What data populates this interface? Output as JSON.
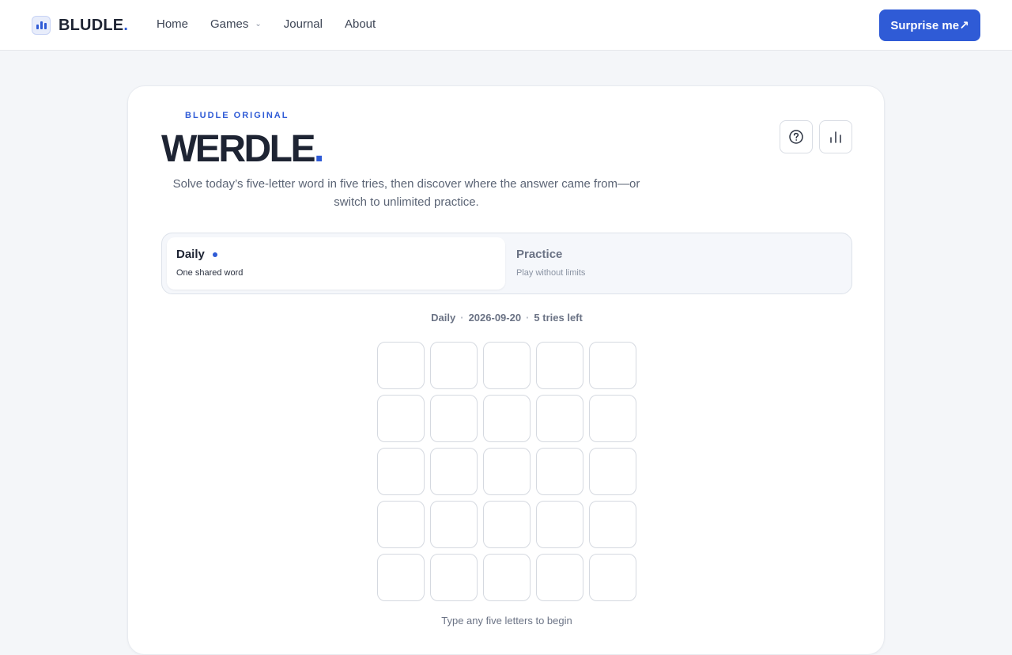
{
  "header": {
    "brand": "BLUDLE",
    "brand_dot": ".",
    "nav": [
      {
        "label": "Home"
      },
      {
        "label": "Games",
        "has_dropdown": true
      },
      {
        "label": "Journal"
      },
      {
        "label": "About"
      }
    ],
    "cta_label": "Surprise me↗"
  },
  "game": {
    "eyebrow": "BLUDLE ORIGINAL",
    "title": "WERDLE",
    "title_dot": ".",
    "subtitle": "Solve today’s five-letter word in five tries, then discover where the answer came from—or switch to unlimited practice.",
    "modes": [
      {
        "title": "Daily",
        "subtitle": "One shared word",
        "active": true
      },
      {
        "title": "Practice",
        "subtitle": "Play without limits",
        "active": false
      }
    ],
    "status": {
      "mode": "Daily",
      "date": "2026-09-20",
      "tries_left": "5 tries left"
    },
    "board": {
      "rows": 5,
      "cols": 5
    },
    "hint": "Type any five letters to begin"
  },
  "colors": {
    "accent": "#2f5bd6",
    "background": "#f4f6f9",
    "text": "#1e2433"
  },
  "icons": {
    "logo": "bar-chart-icon",
    "help": "question-circle-icon",
    "stats": "bar-chart-icon"
  }
}
